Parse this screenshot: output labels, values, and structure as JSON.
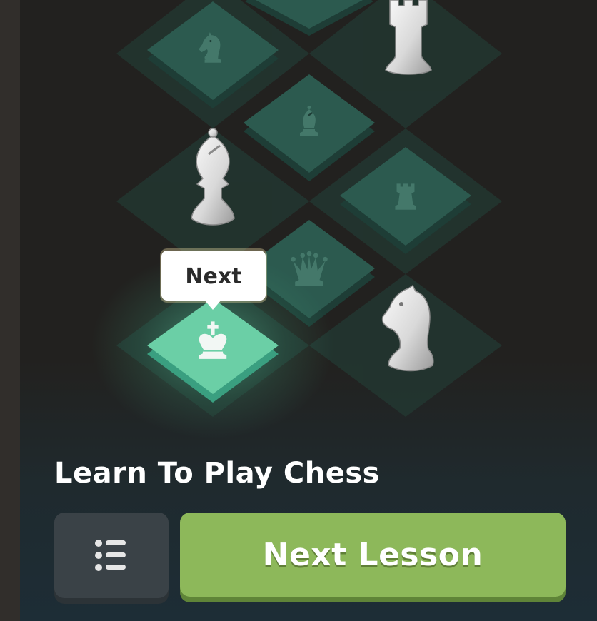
{
  "board": {
    "tooltip_label": "Next",
    "tiles": [
      {
        "piece": "knight",
        "state": "locked"
      },
      {
        "piece": "bishop",
        "state": "locked"
      },
      {
        "piece": "rook",
        "state": "locked"
      },
      {
        "piece": "queen",
        "state": "locked"
      },
      {
        "piece": "king",
        "state": "next"
      }
    ],
    "decorations": [
      "rook",
      "bishop",
      "knight"
    ]
  },
  "course": {
    "title": "Learn To Play Chess"
  },
  "actions": {
    "list_icon": "list-icon",
    "next_label": "Next Lesson"
  },
  "colors": {
    "accent_green": "#8db85a",
    "tile_teal": "#2c5a4f",
    "tile_active": "#6bcfa6",
    "background": "#22211f"
  }
}
